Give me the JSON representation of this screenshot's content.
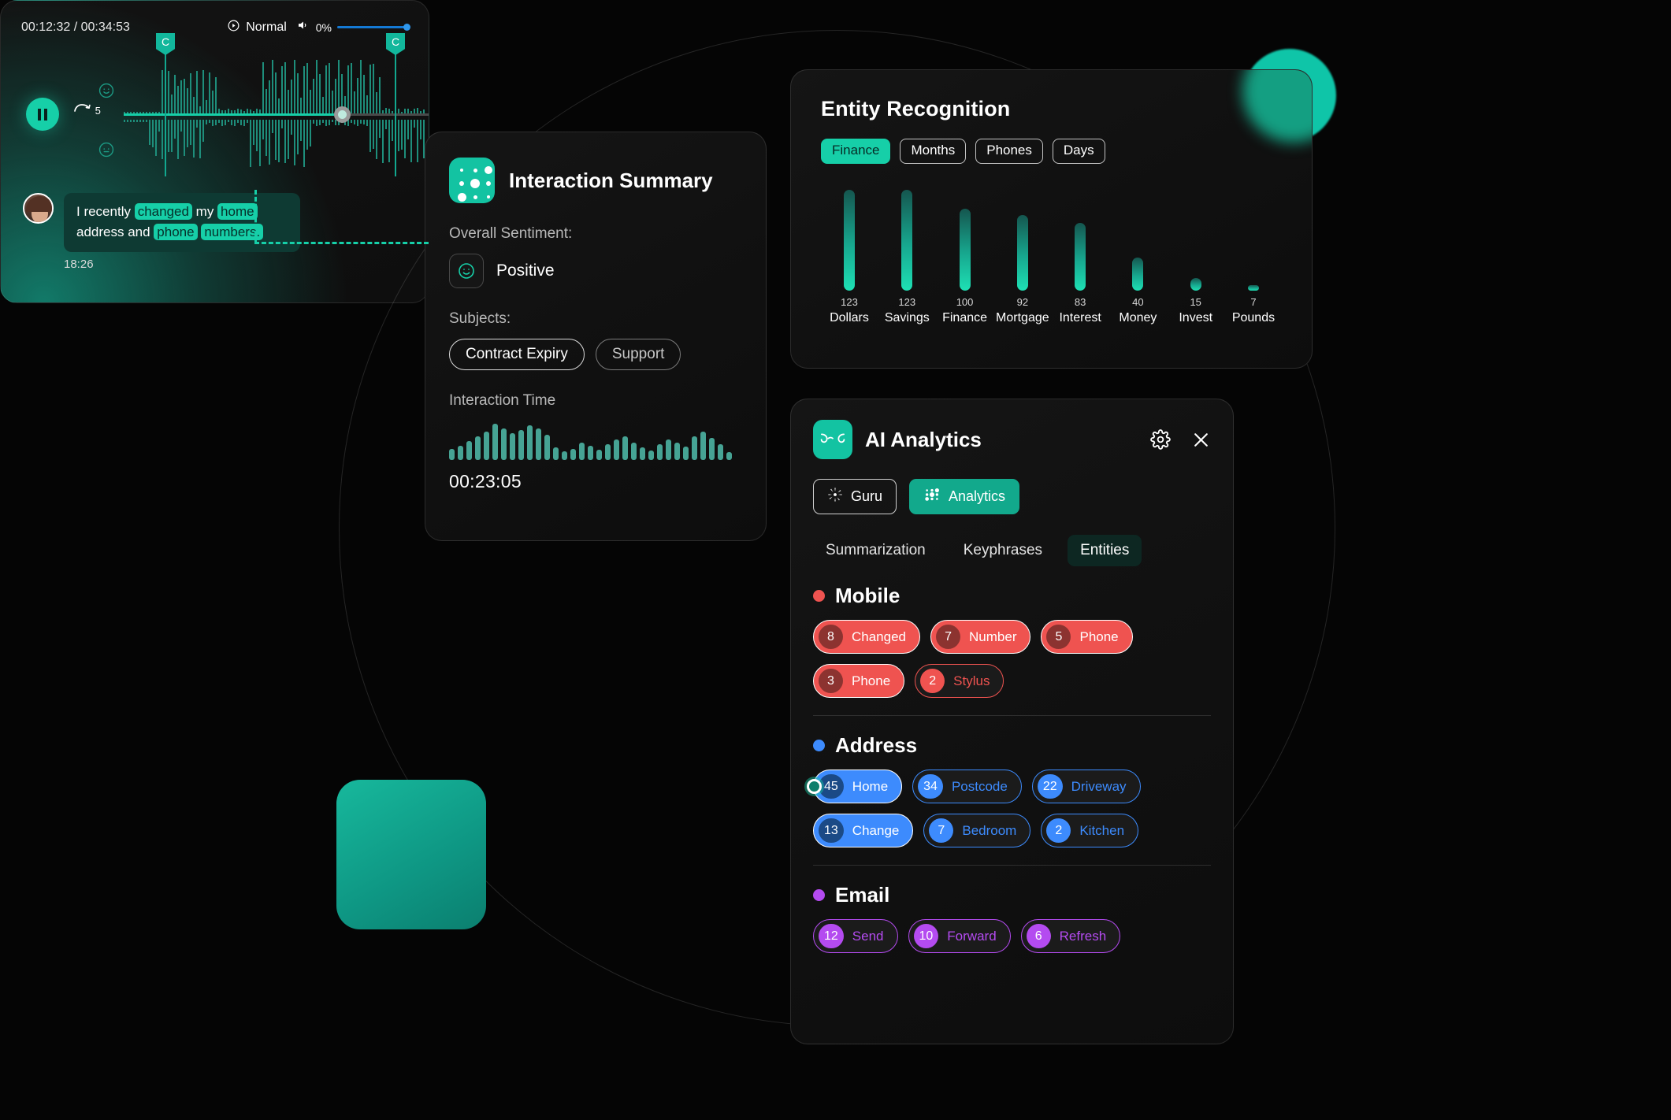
{
  "entity_card": {
    "title": "Entity Recognition",
    "filters": [
      {
        "label": "Finance",
        "active": true
      },
      {
        "label": "Months",
        "active": false
      },
      {
        "label": "Phones",
        "active": false
      },
      {
        "label": "Days",
        "active": false
      }
    ]
  },
  "chart_data": {
    "type": "bar",
    "title": "Entity Recognition",
    "categories": [
      "Dollars",
      "Savings",
      "Finance",
      "Mortgage",
      "Interest",
      "Money",
      "Invest",
      "Pounds"
    ],
    "values": [
      123,
      123,
      100,
      92,
      83,
      40,
      15,
      7
    ],
    "xlabel": "",
    "ylabel": "",
    "ylim": [
      0,
      130
    ],
    "grid": false,
    "legend": "none",
    "bar_color": "#16cfa8",
    "data_labels": [
      "123",
      "123",
      "100",
      "92",
      "83",
      "40",
      "15",
      "7"
    ]
  },
  "summary_card": {
    "title": "Interaction Summary",
    "sentiment_label": "Overall Sentiment:",
    "sentiment_value": "Positive",
    "subjects_label": "Subjects:",
    "subjects": [
      "Contract Expiry",
      "Support"
    ],
    "time_label": "Interaction Time",
    "duration": "00:23:05",
    "waveform": [
      14,
      18,
      24,
      30,
      36,
      46,
      40,
      34,
      38,
      44,
      40,
      32,
      16,
      11,
      14,
      22,
      18,
      13,
      20,
      26,
      30,
      22,
      16,
      12,
      20,
      26,
      22,
      17,
      30,
      36,
      28,
      20,
      10
    ]
  },
  "player": {
    "current_time": "00:12:32",
    "total_time": "00:34:53",
    "time_display": "00:12:32 / 00:34:53",
    "speed": "Normal",
    "volume": "0%",
    "skip_seconds": "5",
    "markers": [
      "C",
      "C"
    ],
    "message": {
      "text_parts": [
        {
          "t": "I recently ",
          "hl": false
        },
        {
          "t": "changed",
          "hl": true
        },
        {
          "t": " my ",
          "hl": false
        },
        {
          "t": "home",
          "hl": true
        },
        {
          "t": " address and ",
          "hl": false
        },
        {
          "t": "phone",
          "hl": true
        },
        {
          "t": " ",
          "hl": false
        },
        {
          "t": "numbers.",
          "hl": true
        }
      ],
      "timestamp": "18:26"
    }
  },
  "ai_panel": {
    "title": "AI Analytics",
    "modes": [
      {
        "label": "Guru",
        "active": false
      },
      {
        "label": "Analytics",
        "active": true
      }
    ],
    "tabs": [
      {
        "label": "Summarization",
        "active": false
      },
      {
        "label": "Keyphrases",
        "active": false
      },
      {
        "label": "Entities",
        "active": true
      }
    ],
    "sections": [
      {
        "name": "Mobile",
        "color": "#ef5350",
        "num_bg": "#8c3330",
        "tags": [
          {
            "count": "8",
            "label": "Changed",
            "style": "filled"
          },
          {
            "count": "7",
            "label": "Number",
            "style": "filled"
          },
          {
            "count": "5",
            "label": "Phone",
            "style": "filled"
          },
          {
            "count": "3",
            "label": "Phone",
            "style": "filled"
          },
          {
            "count": "2",
            "label": "Stylus",
            "style": "outline"
          }
        ]
      },
      {
        "name": "Address",
        "color": "#3d8bfd",
        "num_bg": "#1b4a86",
        "tags": [
          {
            "count": "45",
            "label": "Home",
            "style": "filled",
            "connector": true
          },
          {
            "count": "34",
            "label": "Postcode",
            "style": "outline"
          },
          {
            "count": "22",
            "label": "Driveway",
            "style": "outline"
          },
          {
            "count": "13",
            "label": "Change",
            "style": "filled"
          },
          {
            "count": "7",
            "label": "Bedroom",
            "style": "outline"
          },
          {
            "count": "2",
            "label": "Kitchen",
            "style": "outline"
          }
        ]
      },
      {
        "name": "Email",
        "color": "#b44bf0",
        "num_bg": "#7b2fb0",
        "tags": [
          {
            "count": "12",
            "label": "Send",
            "style": "outline"
          },
          {
            "count": "10",
            "label": "Forward",
            "style": "outline"
          },
          {
            "count": "6",
            "label": "Refresh",
            "style": "outline"
          }
        ]
      }
    ]
  },
  "icons": {
    "dots_grid": "dots-grid-icon",
    "owl": "owl-logo-icon",
    "gear": "gear-icon",
    "close": "close-icon",
    "guru": "starburst-icon",
    "analytics": "dots-grid-icon",
    "smile": "smiley-icon",
    "speed": "playback-speed-icon",
    "volume": "volume-icon",
    "pause": "pause-icon",
    "skip": "skip-forward-icon"
  }
}
